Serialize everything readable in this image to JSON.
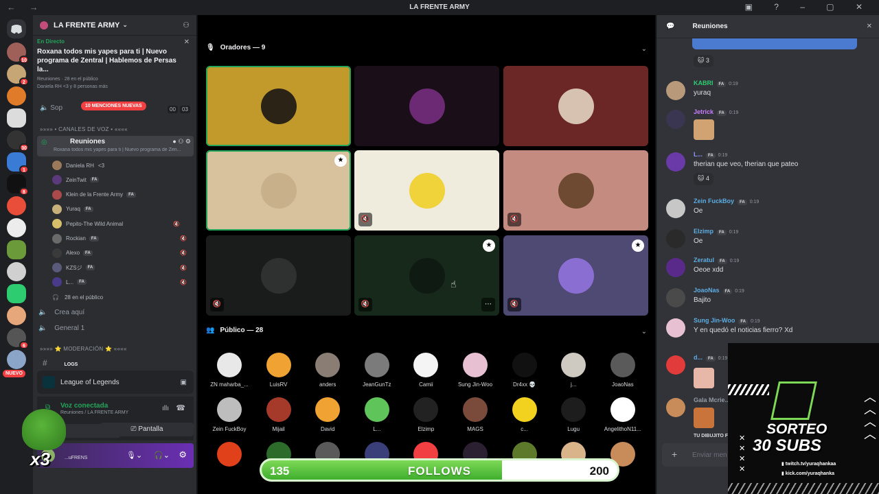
{
  "window": {
    "title": "LA FRENTE ARMY"
  },
  "server": {
    "name": "LA FRENTE ARMY",
    "rail_badges": [
      "10",
      "2",
      "30",
      "1",
      "8",
      "6"
    ],
    "nuevo": "NUEVO"
  },
  "live": {
    "tag": "En Directo",
    "title": "Roxana todos mis yapes para ti | Nuevo programa de Zentral | Hablemos de Persas la...",
    "meta": "Reuniones · 28 en el público",
    "people": "Daniela RH <3 y 8 personas más"
  },
  "sidebar": {
    "mentions": "10 MENCIONES NUEVAS",
    "sop": "Sop",
    "counter_a": "00",
    "counter_b": "03",
    "voice_category": "»»»» • CANALES DE VOZ • ««««",
    "reuniones": {
      "name": "Reuniones",
      "sub": "Roxana todos mis yapes para ti | Nuevo programa de Zen..."
    },
    "voice_users": [
      {
        "name": "Daniela RH",
        "extra": "<3",
        "fa": ""
      },
      {
        "name": "ZeinTwit",
        "extra": "",
        "fa": "FA"
      },
      {
        "name": "Klein de la Frente Army",
        "extra": "",
        "fa": "FA"
      },
      {
        "name": "Yuraq",
        "extra": "",
        "fa": "FA"
      },
      {
        "name": "Pepito-The Wild Animal",
        "extra": "",
        "fa": ""
      },
      {
        "name": "Rockian",
        "extra": "",
        "fa": "FA"
      },
      {
        "name": "Alexo",
        "extra": "",
        "fa": "FA"
      },
      {
        "name": "KZSジ",
        "extra": "",
        "fa": "FA"
      },
      {
        "name": "L...",
        "extra": "",
        "fa": "FA"
      }
    ],
    "audience_count": "28 en el público",
    "crea": "Crea aquí",
    "general": "General 1",
    "mod_category": "»»»» ⭐ MODERACIÓN ⭐ ««««",
    "logs": "LOGS"
  },
  "activity": {
    "label": "League of Legends"
  },
  "voice_panel": {
    "status": "Voz conectada",
    "location": "Reuniones / LA FRENTE ARMY",
    "screen_label": "Pantalla"
  },
  "user_panel": {
    "tag": "...uFRENS"
  },
  "overlay": {
    "multiplier": "x3"
  },
  "stage": {
    "speakers_label": "Oradores — 9",
    "audience_label": "Público — 28",
    "speakers": [
      {
        "bg": "#c29a2c",
        "av": "#2a2316",
        "speaking": true,
        "mute": false,
        "mod": false
      },
      {
        "bg": "#1a0f18",
        "av": "#6b2a73",
        "speaking": false,
        "mute": false,
        "mod": false
      },
      {
        "bg": "#6b2626",
        "av": "#d7c1b1",
        "speaking": false,
        "mute": false,
        "mod": false
      },
      {
        "bg": "#d8c29e",
        "av": "#c8b08a",
        "speaking": true,
        "mute": false,
        "mod": true
      },
      {
        "bg": "#efebdd",
        "av": "#f0d23a",
        "speaking": false,
        "mute": true,
        "mod": false
      },
      {
        "bg": "#c48b80",
        "av": "#6e4a32",
        "speaking": false,
        "mute": true,
        "mod": false
      },
      {
        "bg": "#1a1c1c",
        "av": "#2f3131",
        "speaking": false,
        "mute": true,
        "mod": false
      },
      {
        "bg": "#17291b",
        "av": "#0f1b12",
        "speaking": false,
        "mute": true,
        "mod": true
      },
      {
        "bg": "#4f4a73",
        "av": "#8a6ed1",
        "speaking": false,
        "mute": true,
        "mod": true
      }
    ],
    "audience": [
      {
        "name": "ZN maharba_...",
        "c": "#e8e8e8"
      },
      {
        "name": "LuisRV",
        "c": "#f0a232"
      },
      {
        "name": "anders",
        "c": "#8a7d74"
      },
      {
        "name": "JeanGunTz",
        "c": "#7b7b7b"
      },
      {
        "name": "Camii",
        "c": "#f4f4f4"
      },
      {
        "name": "Sung Jin-Woo",
        "c": "#e7c1d2"
      },
      {
        "name": "Dr4xx 💀",
        "c": "#111111"
      },
      {
        "name": "j...",
        "c": "#cfcac1"
      },
      {
        "name": "JoaoNas",
        "c": "#5a5a5a"
      },
      {
        "name": "Zein FuckBoy",
        "c": "#bdbdbd"
      },
      {
        "name": "Mijail",
        "c": "#a63a2a"
      },
      {
        "name": "David",
        "c": "#f0a232"
      },
      {
        "name": "L...",
        "c": "#5fc45a"
      },
      {
        "name": "Elzimp",
        "c": "#222222"
      },
      {
        "name": "MAGS",
        "c": "#7a4b3a"
      },
      {
        "name": "c...",
        "c": "#f2d21e"
      },
      {
        "name": "Lugu",
        "c": "#1d1d1d"
      },
      {
        "name": "AngelithoN11...",
        "c": "#ffffff"
      },
      {
        "name": "",
        "c": "#e0401a"
      },
      {
        "name": "",
        "c": "#2c6b2a"
      },
      {
        "name": "",
        "c": "#5a5a5a"
      },
      {
        "name": "",
        "c": "#3a3f7a"
      },
      {
        "name": "",
        "c": "#f23f42"
      },
      {
        "name": "",
        "c": "#2a2032"
      },
      {
        "name": "",
        "c": "#5c7a2a"
      },
      {
        "name": "",
        "c": "#d9b48a"
      },
      {
        "name": "",
        "c": "#c88c5a"
      }
    ]
  },
  "follows": {
    "current": 135,
    "goal": 200,
    "label": "FOLLOWS",
    "current_text": "135",
    "goal_text": "200"
  },
  "chat": {
    "channel": "Reuniones",
    "input_placeholder": "Enviar men",
    "reactions": [
      {
        "count": "3"
      },
      {
        "count": "4"
      }
    ],
    "messages": [
      {
        "author": "KABRI",
        "color": "#2ecc71",
        "time": "0:19",
        "text": "yuraq",
        "av": "#b89a7a"
      },
      {
        "author": "Jetrick",
        "color": "#c77dff",
        "time": "0:19",
        "text": "",
        "av": "#3a3550"
      },
      {
        "author": "L...",
        "color": "#8e9aff",
        "time": "0:19",
        "text": "therian que veo, therian que pateo",
        "av": "#6a3aa8"
      },
      {
        "author": "Zein FuckBoy",
        "color": "#5dade2",
        "time": "0:19",
        "text": "Oe",
        "av": "#c7c7c7"
      },
      {
        "author": "Elzimp",
        "color": "#5dade2",
        "time": "0:19",
        "text": "Oe",
        "av": "#2a2a2a"
      },
      {
        "author": "Zeratul",
        "color": "#5dade2",
        "time": "0:19",
        "text": "Oeoe xdd",
        "av": "#5a2a8a"
      },
      {
        "author": "JoaoNas",
        "color": "#5dade2",
        "time": "0:19",
        "text": "Bajito",
        "av": "#4a4a4a"
      },
      {
        "author": "Sung Jin-Woo",
        "color": "#5dade2",
        "time": "0:19",
        "text": "Y en quedó el noticias fierro? Xd",
        "av": "#e7c1d2"
      },
      {
        "author": "d...",
        "color": "#5dade2",
        "time": "0:19",
        "text": "",
        "av": "#e23b3b"
      },
      {
        "author": "Gala Mcrie...",
        "color": "#949ba4",
        "time": "",
        "text": "",
        "av": "#c88c5a"
      }
    ],
    "footer_text": "TU DIBUJITO F"
  },
  "sorteo": {
    "line1": "SORTEO",
    "line2": "30 SUBS",
    "link1": "twitch.tv/yuraqhankaa",
    "link2": "kick.com/yuraqhanka"
  }
}
